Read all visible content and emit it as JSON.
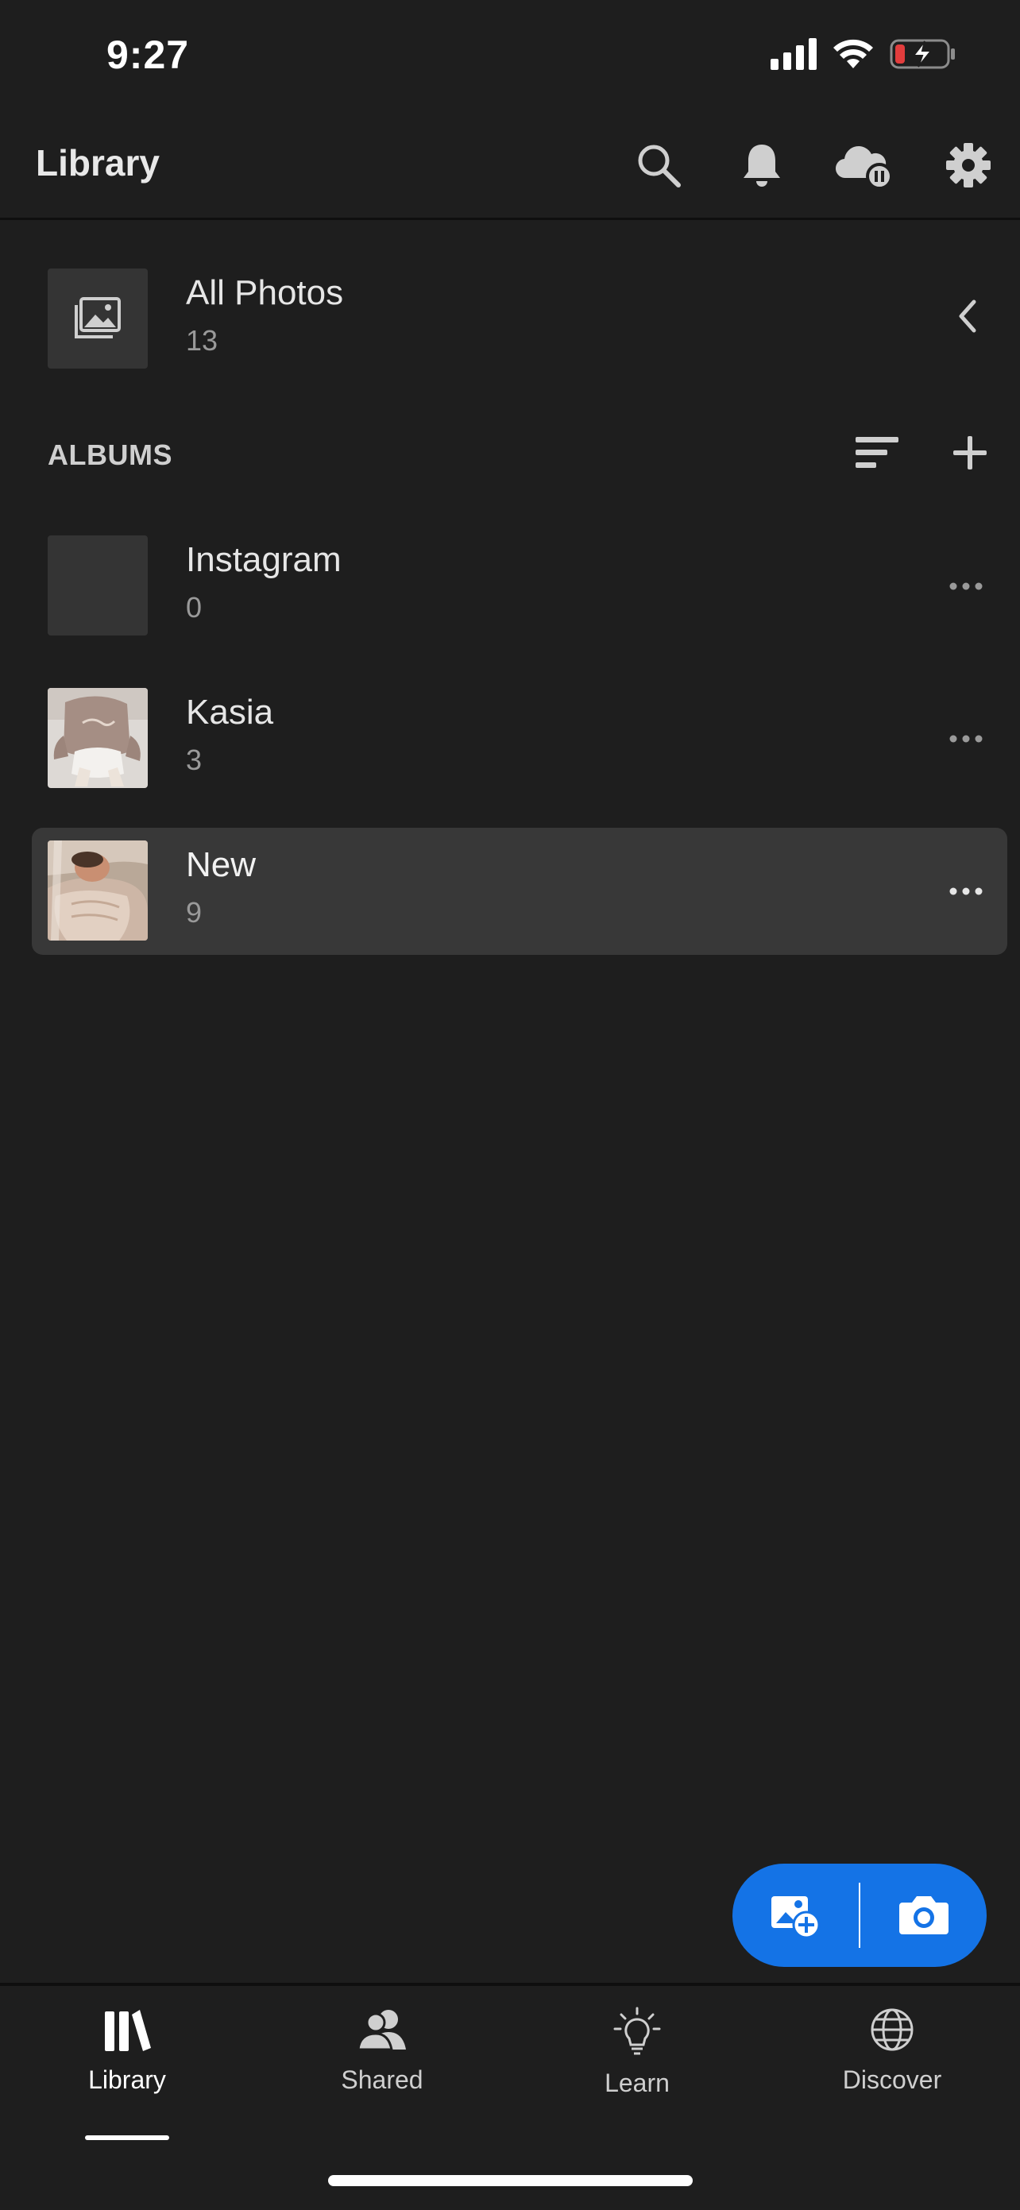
{
  "status_bar": {
    "time": "9:27"
  },
  "header": {
    "title": "Library"
  },
  "all_photos": {
    "title": "All Photos",
    "count": "13"
  },
  "albums": {
    "section_label": "ALBUMS",
    "items": [
      {
        "title": "Instagram",
        "count": "0"
      },
      {
        "title": "Kasia",
        "count": "3"
      },
      {
        "title": "New",
        "count": "9"
      }
    ]
  },
  "tabs": [
    {
      "label": "Library",
      "icon": "library-icon",
      "active": true
    },
    {
      "label": "Shared",
      "icon": "people-icon",
      "active": false
    },
    {
      "label": "Learn",
      "icon": "lightbulb-icon",
      "active": false
    },
    {
      "label": "Discover",
      "icon": "globe-icon",
      "active": false
    }
  ],
  "colors": {
    "accent": "#1473e6",
    "background": "#1e1e1e",
    "selected_row": "#383838",
    "battery_low": "#e23d3d"
  }
}
